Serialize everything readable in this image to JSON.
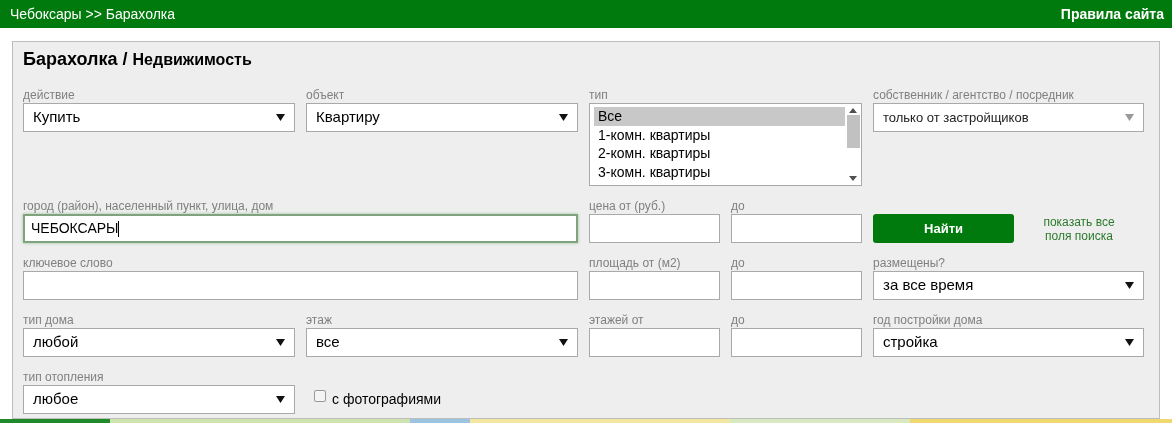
{
  "header": {
    "breadcrumb": "Чебоксары >> Барахолка",
    "rules_link": "Правила сайта"
  },
  "panel": {
    "title": "Барахолка /",
    "subtitle": "Недвижимость",
    "fields": [
      {
        "kind": "select",
        "label": "действие",
        "value": "Купить"
      },
      {
        "kind": "select",
        "label": "объект",
        "value": "Квартиру"
      },
      {
        "kind": "listbox",
        "label": "тип",
        "items": [
          {
            "text": "Все",
            "selected": true
          },
          {
            "text": "1-комн. квартиры",
            "selected": false
          },
          {
            "text": "2-комн. квартиры",
            "selected": false
          },
          {
            "text": "3-комн. квартиры",
            "selected": false
          }
        ]
      },
      {
        "kind": "combo",
        "label": "собственник / агентство / посредник",
        "value": "только от застройщиков"
      },
      {
        "kind": "wide_input",
        "label": "город (район), населенный пункт, улица, дом",
        "value": "ЧЕБОКСАРЫ",
        "focused": true
      },
      {
        "kind": "input",
        "label": "цена от (руб.)"
      },
      {
        "kind": "input",
        "label": "до"
      },
      {
        "kind": "actions",
        "button": "Найти",
        "link": "показать все поля поиска"
      },
      {
        "kind": "wide_input",
        "label": "ключевое слово",
        "focused": false
      },
      {
        "kind": "input",
        "label": "площадь от (м2)"
      },
      {
        "kind": "input",
        "label": "до"
      },
      {
        "kind": "select",
        "label": "размещены?",
        "value": "за все время"
      },
      {
        "kind": "select",
        "label": "тип дома",
        "value": "любой"
      },
      {
        "kind": "select",
        "label": "этаж",
        "value": "все"
      },
      {
        "kind": "input",
        "label": "этажей от"
      },
      {
        "kind": "input",
        "label": "до"
      },
      {
        "kind": "select",
        "label": "год постройки дома",
        "value": "стройка"
      },
      {
        "kind": "select",
        "label": "тип отопления",
        "value": "любое"
      },
      {
        "kind": "checkbox",
        "label": "с фотографиями",
        "checked": false
      }
    ]
  }
}
